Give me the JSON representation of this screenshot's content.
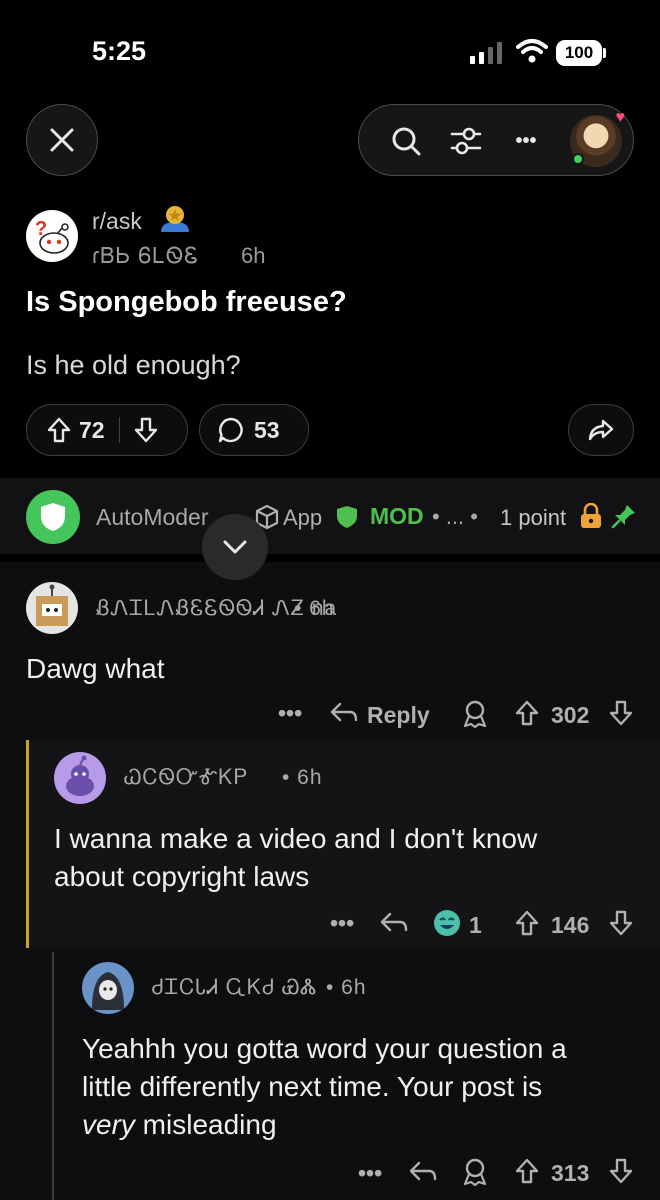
{
  "status_bar": {
    "time": "5:25",
    "battery": "100"
  },
  "top": {
    "close_icon": "close-icon",
    "search_icon": "search-icon",
    "filter_icon": "filter-icon",
    "more_label": "•••"
  },
  "post": {
    "subreddit": "r/ask",
    "author": "ɾᏴᏏ ᏮᏞᏫᏋ",
    "time": "6h",
    "title": "Is Spongebob freeuse?",
    "body": "Is he old enough?",
    "upvotes": "72",
    "comments": "53"
  },
  "automod": {
    "name": "AutoModer",
    "app_label": "App",
    "mod_label": "MOD",
    "dots": "• ... •",
    "points": "1 point"
  },
  "comments": [
    {
      "author": "ᏰᏁᏆᏞᏁᏰᏋᏋᏫᏫᏗ ᏁᏃ",
      "author_suffix": "na",
      "time": "• 6h",
      "text": "Dawg what",
      "reply_label": "Reply",
      "score": "302"
    },
    {
      "author": "ᏇᏟᏫᏅᎹᏦᏢ",
      "time": "• 6h",
      "text_line1": "I wanna make a video and I don't know",
      "text_line2": "about copyright laws",
      "award_count": "1",
      "score": "146"
    },
    {
      "author": "ᏧᏆᏟᏓᏗ ᏩᏦᏧ ᏯᏜ",
      "time": "• 6h",
      "text_line1": "Yeahhh you gotta word your question a",
      "text_line2": "little differently next time. Your post is",
      "text_italic": "very",
      "text_line3_rest": " misleading",
      "score": "313"
    }
  ],
  "colors": {
    "accent_green": "#4fbf4f",
    "mod_shield": "#46c65a",
    "thread_gold": "#c9a227"
  }
}
